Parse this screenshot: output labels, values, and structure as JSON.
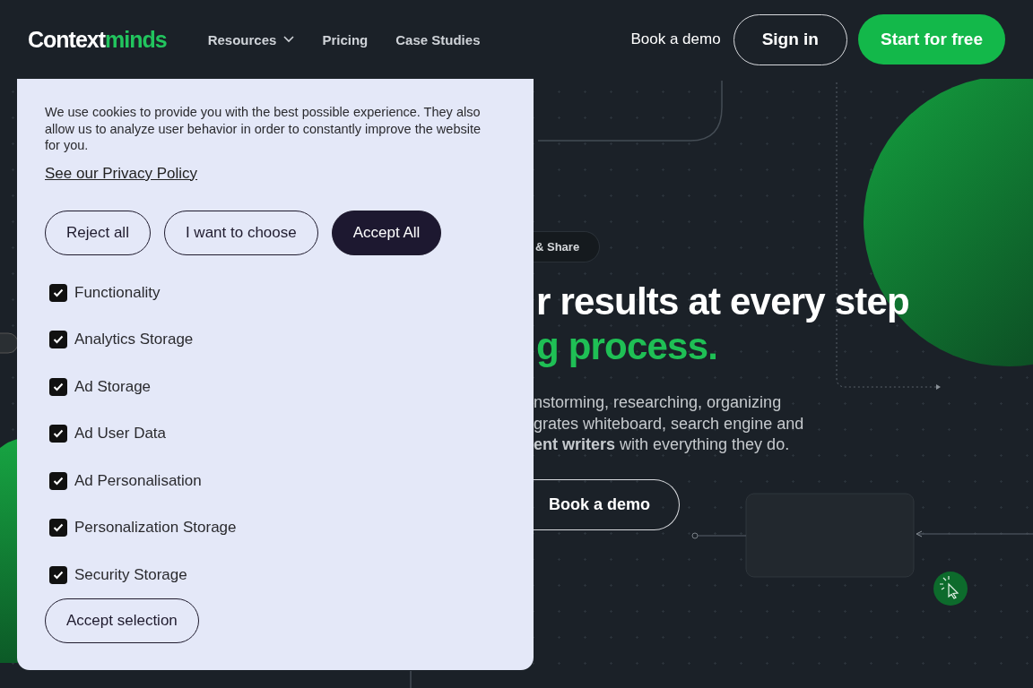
{
  "nav": {
    "logo": {
      "part_1": "Context",
      "part_2": "minds"
    },
    "links": [
      {
        "label": "Resources",
        "has_menu": true
      },
      {
        "label": "Pricing",
        "has_menu": false
      },
      {
        "label": "Case Studies",
        "has_menu": false
      }
    ],
    "book_demo": "Book a demo",
    "sign_in": "Sign in",
    "start_free": "Start for free"
  },
  "cookie_dialog": {
    "description": "We use cookies to provide you with the best possible experience. They also allow us to analyze user behavior in order to constantly improve the website for you.",
    "privacy_link": "See our Privacy Policy",
    "buttons": [
      {
        "label": "Reject all",
        "kind": "outline"
      },
      {
        "label": "I want to choose",
        "kind": "outline"
      },
      {
        "label": "Accept All",
        "kind": "filled"
      }
    ],
    "options": [
      {
        "label": "Functionality",
        "checked": true
      },
      {
        "label": "Analytics Storage",
        "checked": true
      },
      {
        "label": "Ad Storage",
        "checked": true
      },
      {
        "label": "Ad User Data",
        "checked": true
      },
      {
        "label": "Ad Personalisation",
        "checked": true
      },
      {
        "label": "Personalization Storage",
        "checked": true
      },
      {
        "label": "Security Storage",
        "checked": true
      }
    ],
    "accept_selection": "Accept selection"
  },
  "hero": {
    "tag": "& Share",
    "headline_1": "r results at every step",
    "headline_2": "g process.",
    "description_lines": [
      "nstorming, researching, organizing",
      "grates whiteboard, search engine and",
      "**ent writers** with everything they do."
    ],
    "cta": "Book a demo"
  }
}
